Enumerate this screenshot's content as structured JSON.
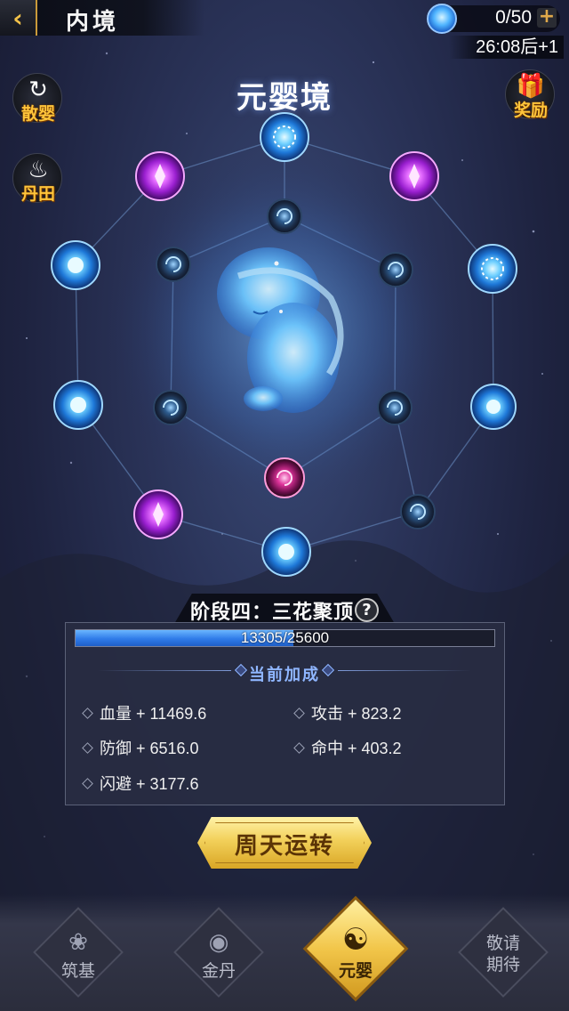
{
  "header": {
    "title": "内境",
    "back_icon": "chevron-left-icon",
    "currency": {
      "icon": "spirit-orb-icon",
      "value": "0/50",
      "add_label": "+"
    },
    "timer": "26:08后+1"
  },
  "side_buttons": [
    {
      "id": "disperse",
      "glyph": "↻",
      "label": "散婴"
    },
    {
      "id": "dantian",
      "glyph": "♨",
      "label": "丹田"
    },
    {
      "id": "reward",
      "glyph": "🎁",
      "label": "奖励"
    }
  ],
  "realm": {
    "title": "元婴境",
    "center_icon": "infant-spirit-icon",
    "node_icons": [
      "blue-orb-icon",
      "purple-orb-icon",
      "dark-orb-icon",
      "lit-blue-orb-icon",
      "magenta-orb-icon"
    ]
  },
  "stage": {
    "label": "阶段四：三花聚顶",
    "help_label": "?",
    "progress_text": "13305/25600",
    "progress_fraction": 0.52
  },
  "bonus": {
    "header": "当前加成",
    "stats": [
      {
        "label": "血量 + 11469.6"
      },
      {
        "label": "攻击 + 823.2"
      },
      {
        "label": "防御 + 6516.0"
      },
      {
        "label": "命中 + 403.2"
      },
      {
        "label": "闪避 + 3177.6"
      }
    ]
  },
  "action_button": {
    "label": "周天运转"
  },
  "nav": {
    "tabs": [
      {
        "label": "筑基",
        "icon": "foundation-icon"
      },
      {
        "label": "金丹",
        "icon": "golden-core-icon"
      },
      {
        "label": "元婴",
        "icon": "nascent-soul-icon",
        "active": true
      },
      {
        "label": "敬请",
        "label2": "期待",
        "icon": ""
      }
    ]
  },
  "colors": {
    "accent_gold": "#f2c64a",
    "label_orange": "#ffc53a",
    "progress_blue": "#2f7be8",
    "node_blue": "#4fb4ff",
    "node_purple": "#c64bff"
  }
}
